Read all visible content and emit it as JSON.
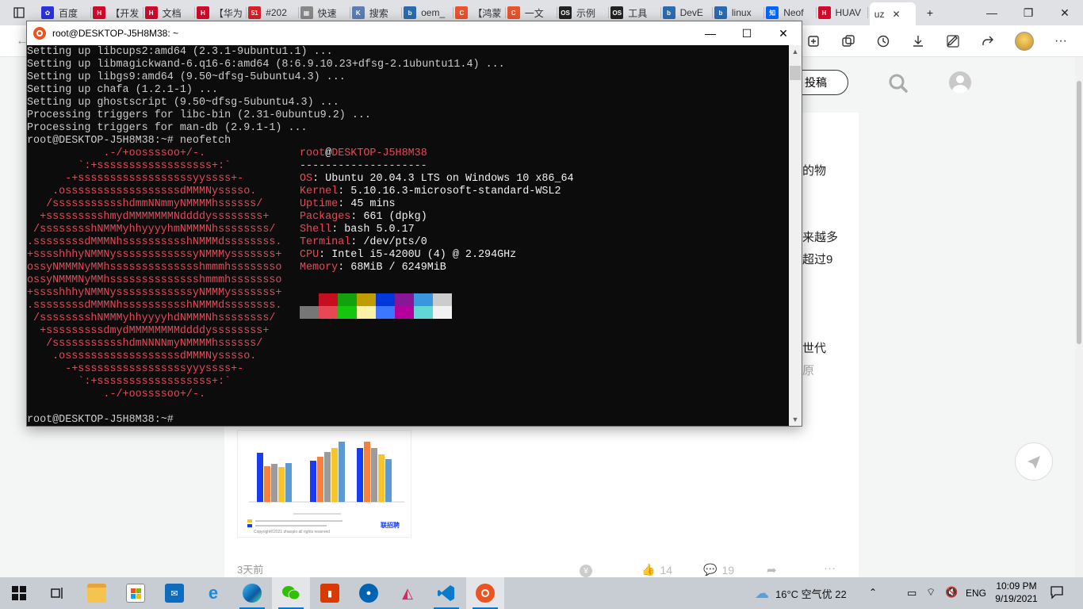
{
  "browser": {
    "tabs": [
      {
        "label": "百度",
        "color": "#2932e1",
        "fav": "✿"
      },
      {
        "label": "【开发",
        "color": "#cf0a2c",
        "fav": "H"
      },
      {
        "label": "文档",
        "color": "#cf0a2c",
        "fav": "H"
      },
      {
        "label": "【华为",
        "color": "#cf0a2c",
        "fav": "H"
      },
      {
        "label": "#202",
        "color": "#d4222a",
        "fav": "51"
      },
      {
        "label": "快速",
        "color": "#888888",
        "fav": "▦"
      },
      {
        "label": "搜索",
        "color": "#5b7fb4",
        "fav": "K"
      },
      {
        "label": "oem_",
        "color": "#2b6cb0",
        "fav": "b"
      },
      {
        "label": "【鸿蒙",
        "color": "#e8542e",
        "fav": "C"
      },
      {
        "label": "一文",
        "color": "#e8542e",
        "fav": "C"
      },
      {
        "label": "示例",
        "color": "#222222",
        "fav": "OS"
      },
      {
        "label": "工具",
        "color": "#222222",
        "fav": "OS"
      },
      {
        "label": "DevE",
        "color": "#2b6cb0",
        "fav": "b"
      },
      {
        "label": "linux",
        "color": "#2b6cb0",
        "fav": "b"
      },
      {
        "label": "Neof",
        "color": "#0066ff",
        "fav": "知"
      },
      {
        "label": "HUAV",
        "color": "#cf0a2c",
        "fav": "H"
      },
      {
        "label": "uz",
        "color": "#ffffff",
        "fav": ""
      }
    ],
    "toolbar": {
      "account_label": "投稿"
    }
  },
  "page_side_texts": [
    "的物",
    "来越多",
    "超过9",
    "世代",
    "原"
  ],
  "article_footer": {
    "time": "3天前",
    "likes": "14",
    "comments": "19"
  },
  "chart": {
    "legend_note": "联招聘",
    "copyright": "Copyright©2021 zhaopin all rights reserved"
  },
  "terminal": {
    "title": "root@DESKTOP-J5H8M38: ~",
    "lines": [
      "Setting up libcups2:amd64 (2.3.1-9ubuntu1.1) ...",
      "Setting up libmagickwand-6.q16-6:amd64 (8:6.9.10.23+dfsg-2.1ubuntu11.4) ...",
      "Setting up libgs9:amd64 (9.50~dfsg-5ubuntu4.3) ...",
      "Setting up chafa (1.2.1-1) ...",
      "Setting up ghostscript (9.50~dfsg-5ubuntu4.3) ...",
      "Processing triggers for libc-bin (2.31-0ubuntu9.2) ...",
      "Processing triggers for man-db (2.9.1-1) ...",
      "root@DESKTOP-J5H8M38:~# neofetch"
    ],
    "logo": [
      "            .-/+oossssoo+/-.",
      "        `:+ssssssssssssssssss+:`",
      "      -+ssssssssssssssssssyyssss+-",
      "    .ossssssssssssssssssdMMMNysssso.",
      "   /ssssssssssshdmmNNmmyNMMMMhssssss/",
      "  +ssssssssshmydMMMMMMMNddddyssssssss+",
      " /sssssssshNMMMyhhyyyyhmNMMMNhssssssss/",
      ".ssssssssdMMMNhsssssssssshNMMMdssssssss.",
      "+sssshhhyNMMNyssssssssssssyNMMMysssssss+",
      "ossyNMMMNyMMhsssssssssssssshmmmhssssssso",
      "ossyNMMMNyMMhsssssssssssssshmmmhssssssso",
      "+sssshhhyNMMNyssssssssssssyNMMMysssssss+",
      ".ssssssssdMMMNhsssssssssshNMMMdssssssss.",
      " /sssssssshNMMMyhhyyyyhdNMMMNhssssssss/",
      "  +sssssssssdmydMMMMMMMMddddyssssssss+",
      "   /ssssssssssshdmNNNNmyNMMMMhssssss/",
      "    .ossssssssssssssssssdMMMNysssso.",
      "      -+sssssssssssssssssyyyssss+-",
      "        `:+ssssssssssssssssss+:`",
      "            .-/+oossssoo+/-."
    ],
    "info_user": "root",
    "info_at": "@",
    "info_host": "DESKTOP-J5H8M38",
    "info_rule": "--------------------",
    "info": [
      {
        "key": "OS",
        "value": "Ubuntu 20.04.3 LTS on Windows 10 x86_64"
      },
      {
        "key": "Kernel",
        "value": "5.10.16.3-microsoft-standard-WSL2"
      },
      {
        "key": "Uptime",
        "value": "45 mins"
      },
      {
        "key": "Packages",
        "value": "661 (dpkg)"
      },
      {
        "key": "Shell",
        "value": "bash 5.0.17"
      },
      {
        "key": "Terminal",
        "value": "/dev/pts/0"
      },
      {
        "key": "CPU",
        "value": "Intel i5-4200U (4) @ 2.294GHz"
      },
      {
        "key": "Memory",
        "value": "68MiB / 6249MiB"
      }
    ],
    "palette_top": [
      "#0c0c0c",
      "#c50f1f",
      "#13a10e",
      "#c19c00",
      "#0037da",
      "#881798",
      "#3a96dd",
      "#cccccc"
    ],
    "palette_bottom": [
      "#767676",
      "#e74856",
      "#16c60c",
      "#f9f1a5",
      "#3b78ff",
      "#b4009e",
      "#61d6d6",
      "#f2f2f2"
    ],
    "prompt": "root@DESKTOP-J5H8M38:~#"
  },
  "taskbar": {
    "weather": "16°C 空气优 22",
    "lang": "ENG",
    "time": "10:09 PM",
    "date": "9/19/2021"
  }
}
